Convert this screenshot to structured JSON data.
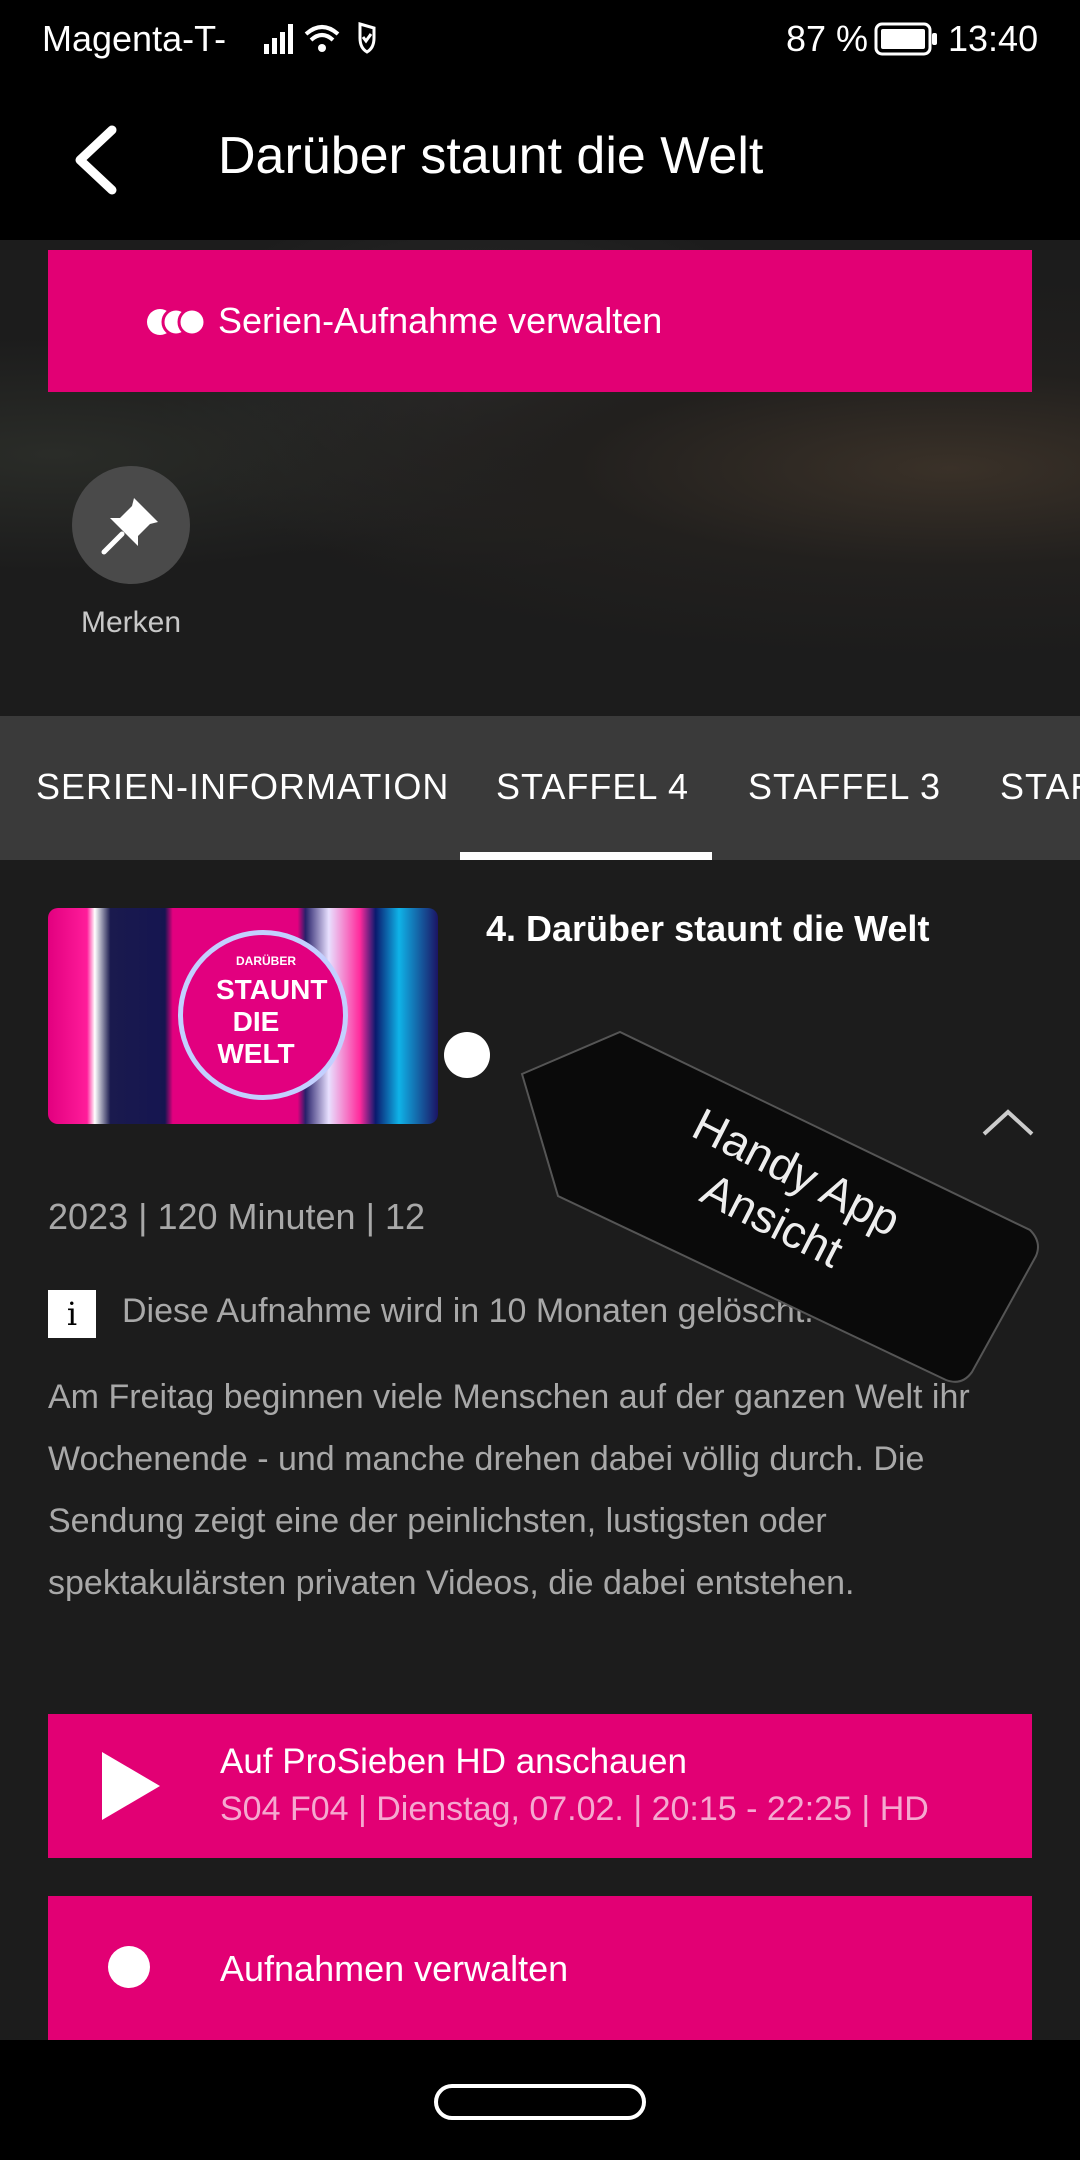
{
  "status_bar": {
    "carrier": "Magenta-T-",
    "battery_percent": "87 %",
    "time": "13:40"
  },
  "app_bar": {
    "title": "Darüber staunt die Welt"
  },
  "series_recording_button": {
    "label": "Serien-Aufnahme verwalten"
  },
  "watchlist": {
    "label": "Merken"
  },
  "tabs": [
    {
      "label": "SERIEN-INFORMATION",
      "active": false
    },
    {
      "label": "STAFFEL 4",
      "active": true
    },
    {
      "label": "STAFFEL 3",
      "active": false
    },
    {
      "label": "STAFFEL",
      "active": false
    }
  ],
  "episode": {
    "title": "4. Darüber staunt die Welt",
    "thumbnail_text_small": "DARÜBER",
    "thumbnail_text_big": "STAUNT DIE WELT",
    "meta": "2023  |  120 Minuten  |  12",
    "info_note": "Diese Aufnahme wird in 10 Monaten gelöscht.",
    "description": "Am Freitag beginnen viele Menschen auf der ganzen Welt ihr Wochenende - und manche drehen dabei völlig durch. Die Sendung zeigt eine der peinlichsten, lustigsten oder spektakulärsten privaten Videos, die dabei entstehen."
  },
  "watch_button": {
    "line1": "Auf ProSieben HD anschauen",
    "line2": "S04 F04  |  Dienstag, 07.02.  |  20:15 - 22:25  |  HD"
  },
  "recordings_button": {
    "label": "Aufnahmen verwalten"
  },
  "sticker": {
    "text": "Handy App\nAnsicht"
  },
  "colors": {
    "magenta": "#e20074",
    "background": "#1c1c1c",
    "tab_bar": "#3a3a3a"
  }
}
